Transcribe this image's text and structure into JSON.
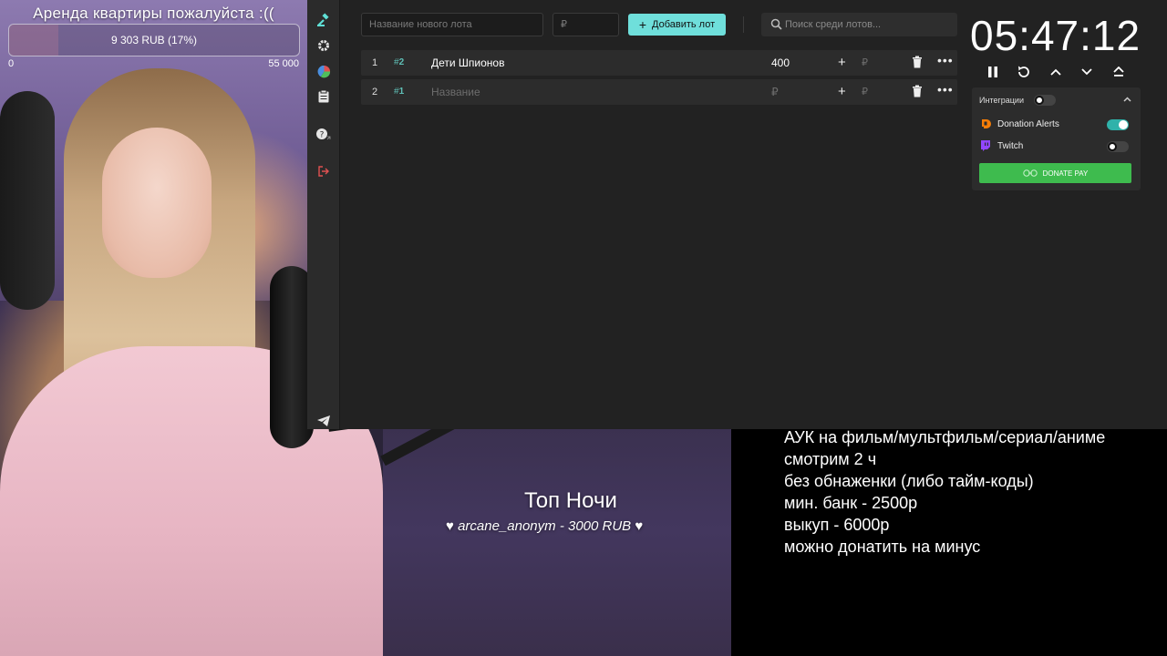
{
  "goal": {
    "title": "Аренда квартиры пожалуйста :((",
    "progress_text": "9 303 RUB (17%)",
    "progress": 0.17,
    "min_label": "0",
    "max_label": "55 000"
  },
  "nav": {
    "items": [
      "auction-icon",
      "gear-icon",
      "pie-chart-icon",
      "clipboard-icon",
      "help-icon",
      "logout-icon",
      "telegram-icon"
    ]
  },
  "toolbar": {
    "new_lot_placeholder": "Название нового лота",
    "amount_placeholder": "₽",
    "add_lot_label": "Добавить лот",
    "search_placeholder": "Поиск среди лотов..."
  },
  "lots": [
    {
      "index": "1",
      "tag": "2",
      "name": "Дети Шпионов",
      "amount": "400"
    },
    {
      "index": "2",
      "tag": "1",
      "name": "",
      "name_placeholder": "Название",
      "amount": "",
      "amount_placeholder": "₽"
    }
  ],
  "lot_common": {
    "plus": "+",
    "rub": "₽",
    "dots": "•••",
    "hash": "#"
  },
  "timer": {
    "value": "05:47:12"
  },
  "integrations": {
    "title": "Интеграции",
    "services": [
      {
        "name": "Donation Alerts",
        "enabled": true,
        "color": "#f57d07"
      },
      {
        "name": "Twitch",
        "enabled": false,
        "color": "#9146ff"
      }
    ],
    "donate_pay_label": "DONATE PAY"
  },
  "overlay": {
    "top_title": "Топ Ночи",
    "top_entry": "arcane_anonym - 3000 RUB",
    "heart": "♥",
    "rules": [
      "АУК на фильм/мультфильм/сериал/аниме",
      "смотрим 2 ч",
      "без обнаженки (либо тайм-коды)",
      "мин. банк - 2500р",
      "выкуп - 6000р",
      "можно донатить на минус"
    ]
  },
  "colors": {
    "accent": "#6fdfdb",
    "panel": "#222222",
    "row": "#2c2c2c",
    "donate_pay": "#3ebb4e",
    "danger": "#e05151"
  }
}
